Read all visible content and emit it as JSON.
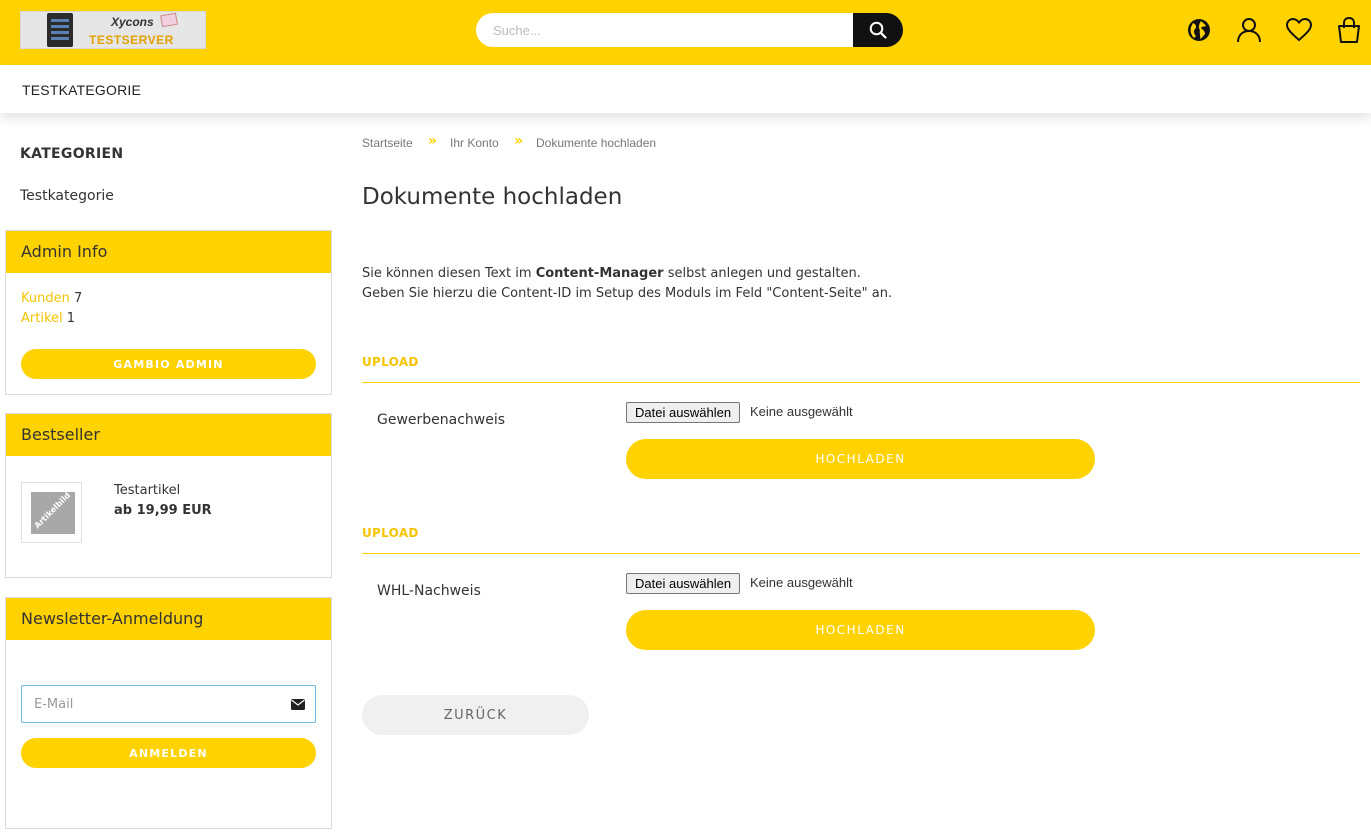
{
  "header": {
    "logo_text_top": "Xycons",
    "logo_text_bottom": "TESTSERVER",
    "search_placeholder": "Suche...",
    "icons": [
      "globe-icon",
      "user-icon",
      "heart-icon",
      "shopping-bag-icon"
    ]
  },
  "nav": {
    "items": [
      {
        "label": "TESTKATEGORIE"
      }
    ]
  },
  "sidebar": {
    "categories_title": "KATEGORIEN",
    "categories": [
      {
        "label": "Testkategorie"
      }
    ],
    "admin_info": {
      "title": "Admin Info",
      "customers_label": "Kunden",
      "customers_count": "7",
      "articles_label": "Artikel",
      "articles_count": "1",
      "button": "GAMBIO ADMIN"
    },
    "bestseller": {
      "title": "Bestseller",
      "thumb_text": "Artikelbild",
      "product_name": "Testartikel",
      "product_price": "ab 19,99 EUR"
    },
    "newsletter": {
      "title": "Newsletter-Anmeldung",
      "email_placeholder": "E-Mail",
      "button": "ANMELDEN"
    }
  },
  "breadcrumb": [
    {
      "label": "Startseite"
    },
    {
      "label": "Ihr Konto"
    },
    {
      "label": "Dokumente hochladen"
    }
  ],
  "breadcrumb_separator": "»",
  "main": {
    "title": "Dokumente hochladen",
    "intro_line1_pre": "Sie können diesen Text im ",
    "intro_line1_bold": "Content-Manager",
    "intro_line1_post": " selbst anlegen und gestalten.",
    "intro_line2": "Geben Sie hierzu die Content-ID im Setup des Moduls im Feld \"Content-Seite\" an.",
    "uploads": [
      {
        "section_title": "UPLOAD",
        "field_label": "Gewerbenachweis",
        "file_button": "Datei auswählen",
        "file_status": "Keine ausgewählt",
        "submit": "HOCHLADEN"
      },
      {
        "section_title": "UPLOAD",
        "field_label": "WHL-Nachweis",
        "file_button": "Datei auswählen",
        "file_status": "Keine ausgewählt",
        "submit": "HOCHLADEN"
      }
    ],
    "back_button": "ZURÜCK"
  },
  "colors": {
    "accent": "#ffd200",
    "link": "#f5c400",
    "dark": "#111111"
  }
}
